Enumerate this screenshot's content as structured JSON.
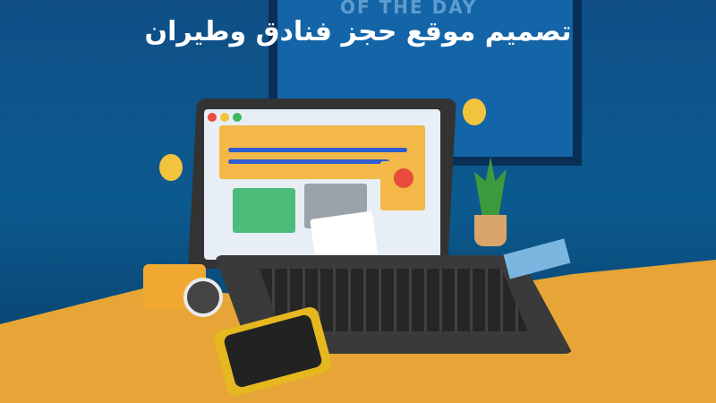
{
  "title": "تصميم موقع حجز فنادق وطيران",
  "background_sign": "OF THE DAY",
  "colors": {
    "background": "#0f4f86",
    "desk": "#e6a536",
    "accent": "#2f5ccf",
    "title_text": "#ffffff"
  },
  "icons": [
    "laptop",
    "camera",
    "smartphone",
    "plant",
    "book",
    "balloon",
    "play-button",
    "image-icon"
  ]
}
